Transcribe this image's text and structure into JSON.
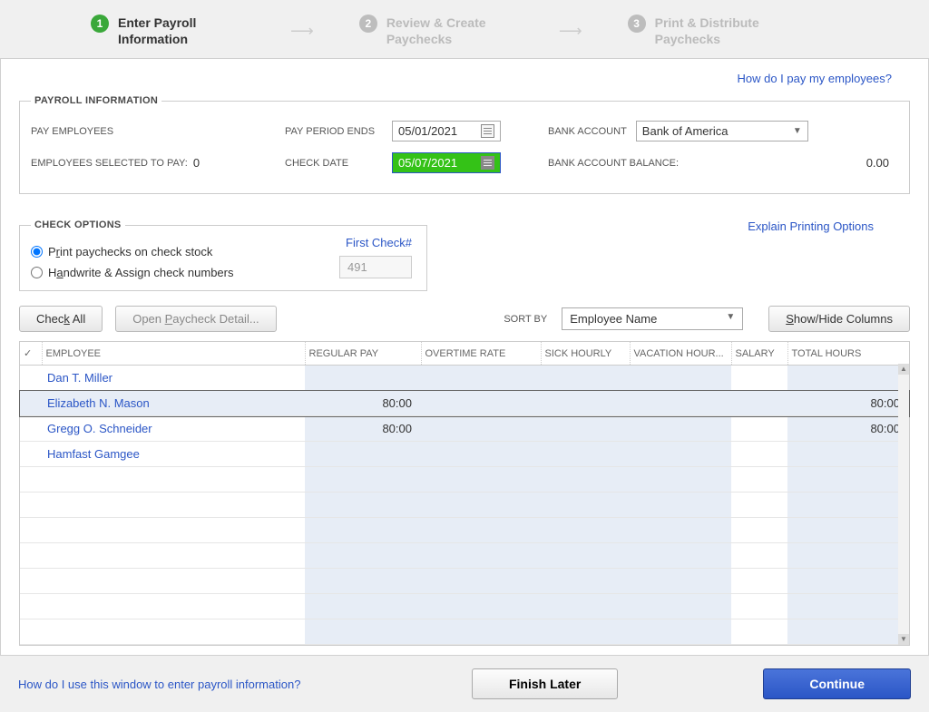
{
  "wizard": {
    "steps": [
      {
        "num": "1",
        "label": "Enter Payroll Information",
        "active": true
      },
      {
        "num": "2",
        "label": "Review & Create Paychecks",
        "active": false
      },
      {
        "num": "3",
        "label": "Print & Distribute Paychecks",
        "active": false
      }
    ]
  },
  "links": {
    "how_pay": "How do I pay my employees?",
    "explain_printing": "Explain Printing Options",
    "footer_help": "How do I use this window to enter payroll information?"
  },
  "payroll_info": {
    "legend": "PAYROLL INFORMATION",
    "pay_employees_label": "PAY EMPLOYEES",
    "employees_selected_label": "EMPLOYEES SELECTED TO PAY:",
    "employees_selected_value": "0",
    "pay_period_ends_label": "PAY PERIOD ENDS",
    "pay_period_ends_value": "05/01/2021",
    "check_date_label": "CHECK DATE",
    "check_date_value": "05/07/2021",
    "bank_account_label": "BANK ACCOUNT",
    "bank_account_value": "Bank of America",
    "bank_balance_label": "BANK ACCOUNT BALANCE:",
    "bank_balance_value": "0.00"
  },
  "check_options": {
    "legend": "CHECK OPTIONS",
    "print_label_pre": "P",
    "print_label_u": "r",
    "print_label_post": "int paychecks on check stock",
    "handwrite_label_pre": "H",
    "handwrite_label_u": "a",
    "handwrite_label_post": "ndwrite & Assign check numbers",
    "first_check_label": "First Check#",
    "first_check_value": "491"
  },
  "controls": {
    "check_all_pre": "Chec",
    "check_all_u": "k",
    "check_all_post": " All",
    "open_detail_pre": "Open ",
    "open_detail_u": "P",
    "open_detail_post": "aycheck Detail...",
    "sort_by_label": "SORT BY",
    "sort_by_value": "Employee Name",
    "show_hide_u": "S",
    "show_hide_post": "how/Hide Columns"
  },
  "table": {
    "headers": {
      "check": "✓",
      "employee": "EMPLOYEE",
      "regular_pay": "REGULAR PAY",
      "overtime_rate": "OVERTIME RATE",
      "sick_hourly": "SICK HOURLY",
      "vacation_hour": "VACATION HOUR...",
      "salary": "SALARY",
      "total_hours": "TOTAL HOURS"
    },
    "rows": [
      {
        "name": "Dan T. Miller",
        "regular": "",
        "total": "",
        "sel": false
      },
      {
        "name": "Elizabeth N. Mason",
        "regular": "80:00",
        "total": "80:00",
        "sel": true
      },
      {
        "name": "Gregg O. Schneider",
        "regular": "80:00",
        "total": "80:00",
        "sel": false
      },
      {
        "name": "Hamfast Gamgee",
        "regular": "",
        "total": "",
        "sel": false
      }
    ]
  },
  "footer": {
    "finish_later": "Finish Later",
    "continue": "Continue"
  }
}
